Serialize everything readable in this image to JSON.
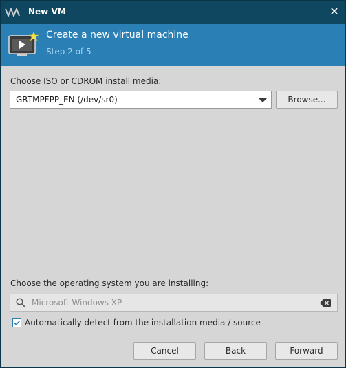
{
  "titlebar": {
    "title": "New VM"
  },
  "header": {
    "title": "Create a new virtual machine",
    "step": "Step 2 of 5"
  },
  "media": {
    "label": "Choose ISO or CDROM install media:",
    "selected": "GRTMPFPP_EN (/dev/sr0)",
    "browse_label": "Browse..."
  },
  "os": {
    "label": "Choose the operating system you are installing:",
    "placeholder": "Microsoft Windows XP",
    "auto_detect_label": "Automatically detect from the installation media / source",
    "auto_detect_checked": true
  },
  "footer": {
    "cancel": "Cancel",
    "back": "Back",
    "forward": "Forward"
  },
  "icons": {
    "app": "virt-manager-icon",
    "close": "close-icon",
    "vm": "vm-screen-icon",
    "dropdown": "chevron-down-icon",
    "search": "search-icon",
    "clear": "clear-icon",
    "check": "checkmark-icon"
  },
  "colors": {
    "titlebar": "#0f4761",
    "header": "#2a7fb5",
    "step_text": "#a9d6f5",
    "background": "#d6d6d6"
  }
}
